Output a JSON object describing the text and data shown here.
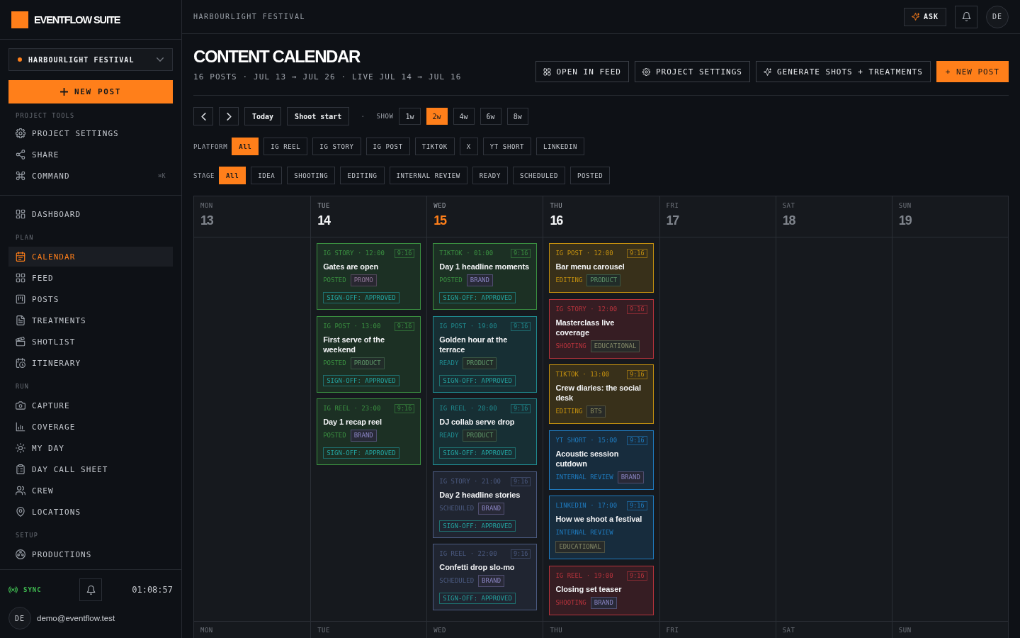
{
  "sidebar": {
    "brand": "EVENTFLOW SUITE",
    "project": "HARBOURLIGHT FESTIVAL",
    "new_post": "NEW POST",
    "tools": {
      "label": "PROJECT TOOLS",
      "items": [
        {
          "label": "PROJECT SETTINGS"
        },
        {
          "label": "SHARE"
        },
        {
          "label": "COMMAND",
          "shortcut": "⌘K"
        }
      ]
    },
    "nav": [
      {
        "items": [
          {
            "label": "DASHBOARD",
            "selected": false
          }
        ]
      },
      {
        "label": "PLAN",
        "items": [
          {
            "label": "CALENDAR",
            "selected": true
          },
          {
            "label": "FEED",
            "selected": false
          },
          {
            "label": "POSTS",
            "selected": false
          },
          {
            "label": "TREATMENTS",
            "selected": false
          },
          {
            "label": "SHOTLIST",
            "selected": false
          },
          {
            "label": "ITINERARY",
            "selected": false
          }
        ]
      },
      {
        "label": "RUN",
        "items": [
          {
            "label": "CAPTURE",
            "selected": false
          },
          {
            "label": "COVERAGE",
            "selected": false
          },
          {
            "label": "MY DAY",
            "selected": false
          },
          {
            "label": "DAY CALL SHEET",
            "selected": false
          },
          {
            "label": "CREW",
            "selected": false
          },
          {
            "label": "LOCATIONS",
            "selected": false
          }
        ]
      },
      {
        "label": "SETUP",
        "items": [
          {
            "label": "PRODUCTIONS",
            "selected": false
          }
        ]
      }
    ],
    "footer": {
      "sync": "SYNC",
      "time": "01:08:57",
      "initials": "DE",
      "email": "demo@eventflow.test"
    }
  },
  "topbar": {
    "breadcrumb": "HARBOURLIGHT FESTIVAL",
    "ask": "ASK",
    "initials": "DE"
  },
  "header": {
    "title": "CONTENT CALENDAR",
    "subtitle": "16 POSTS · JUL 13 → JUL 26 · LIVE JUL 14 → JUL 16",
    "actions": [
      {
        "label": "OPEN IN FEED",
        "kind": "outline"
      },
      {
        "label": "PROJECT SETTINGS",
        "kind": "outline"
      },
      {
        "label": "GENERATE SHOTS + TREATMENTS",
        "kind": "outline"
      },
      {
        "label": "+ NEW POST",
        "kind": "primary"
      }
    ]
  },
  "toolbar": {
    "buttons": [
      "Today",
      "Shoot start"
    ],
    "separator": "·",
    "show_label": "SHOW",
    "ranges": [
      {
        "label": "1w",
        "selected": false
      },
      {
        "label": "2w",
        "selected": true
      },
      {
        "label": "4w",
        "selected": false
      },
      {
        "label": "6w",
        "selected": false
      },
      {
        "label": "8w",
        "selected": false
      }
    ]
  },
  "filters": [
    {
      "label": "PLATFORM",
      "options": [
        {
          "label": "All",
          "selected": true
        },
        {
          "label": "IG REEL",
          "selected": false
        },
        {
          "label": "IG STORY",
          "selected": false
        },
        {
          "label": "IG POST",
          "selected": false
        },
        {
          "label": "TIKTOK",
          "selected": false
        },
        {
          "label": "X",
          "selected": false
        },
        {
          "label": "YT SHORT",
          "selected": false
        },
        {
          "label": "LINKEDIN",
          "selected": false
        }
      ]
    },
    {
      "label": "STAGE",
      "options": [
        {
          "label": "All",
          "selected": true
        },
        {
          "label": "IDEA",
          "selected": false
        },
        {
          "label": "SHOOTING",
          "selected": false
        },
        {
          "label": "EDITING",
          "selected": false
        },
        {
          "label": "INTERNAL REVIEW",
          "selected": false
        },
        {
          "label": "READY",
          "selected": false
        },
        {
          "label": "SCHEDULED",
          "selected": false
        },
        {
          "label": "POSTED",
          "selected": false
        }
      ]
    }
  ],
  "calendar": {
    "weeks": [
      {
        "days": [
          {
            "name": "MON",
            "number": "13",
            "today": false,
            "live": false
          },
          {
            "name": "TUE",
            "number": "14",
            "today": false,
            "live": true,
            "posts": [
              {
                "meta": "IG STORY · 12:00",
                "ratio": "9:16",
                "title": "Gates are open",
                "stage": "POSTED",
                "color": "#3a8f40",
                "tag": {
                  "label": "PROMO",
                  "color": "#8e7596"
                },
                "signoff": "SIGN-OFF: APPROVED"
              },
              {
                "meta": "IG POST · 13:00",
                "ratio": "9:16",
                "title": "First serve of the weekend",
                "stage": "POSTED",
                "color": "#3a8f40",
                "tag": {
                  "label": "PRODUCT",
                  "color": "#5e9468"
                },
                "signoff": "SIGN-OFF: APPROVED"
              },
              {
                "meta": "IG REEL · 23:00",
                "ratio": "9:16",
                "title": "Day 1 recap reel",
                "stage": "POSTED",
                "color": "#3a8f40",
                "tag": {
                  "label": "BRAND",
                  "color": "#8984c2"
                },
                "signoff": "SIGN-OFF: APPROVED"
              }
            ]
          },
          {
            "name": "WED",
            "number": "15",
            "today": true,
            "live": true,
            "posts": [
              {
                "meta": "TIKTOK · 01:00",
                "ratio": "9:16",
                "title": "Day 1 headline moments",
                "stage": "POSTED",
                "color": "#3a8f40",
                "tag": {
                  "label": "BRAND",
                  "color": "#8984c2"
                },
                "signoff": "SIGN-OFF: APPROVED"
              },
              {
                "meta": "IG POST · 19:00",
                "ratio": "9:16",
                "title": "Golden hour at the terrace",
                "stage": "READY",
                "color": "#1f8a8f",
                "tag": {
                  "label": "PRODUCT",
                  "color": "#5e9468"
                },
                "signoff": "SIGN-OFF: APPROVED"
              },
              {
                "meta": "IG REEL · 20:00",
                "ratio": "9:16",
                "title": "DJ collab serve drop",
                "stage": "READY",
                "color": "#1f8a8f",
                "tag": {
                  "label": "PRODUCT",
                  "color": "#5e9468"
                },
                "signoff": "SIGN-OFF: APPROVED"
              },
              {
                "meta": "IG STORY · 21:00",
                "ratio": "9:16",
                "title": "Day 2 headline stories",
                "stage": "SCHEDULED",
                "color": "#4b5a80",
                "tag": {
                  "label": "BRAND",
                  "color": "#8984c2"
                },
                "signoff": "SIGN-OFF: APPROVED"
              },
              {
                "meta": "IG REEL · 22:00",
                "ratio": "9:16",
                "title": "Confetti drop slo-mo",
                "stage": "SCHEDULED",
                "color": "#4b5a80",
                "tag": {
                  "label": "BRAND",
                  "color": "#8984c2"
                },
                "signoff": "SIGN-OFF: APPROVED"
              }
            ]
          },
          {
            "name": "THU",
            "number": "16",
            "today": false,
            "live": true,
            "posts": [
              {
                "meta": "IG POST · 12:00",
                "ratio": "9:16",
                "title": "Bar menu carousel",
                "stage": "EDITING",
                "color": "#c4900f",
                "tag": {
                  "label": "PRODUCT",
                  "color": "#5e9468"
                }
              },
              {
                "meta": "IG STORY · 12:00",
                "ratio": "9:16",
                "title": "Masterclass live coverage",
                "stage": "SHOOTING",
                "color": "#b8333c",
                "tag": {
                  "label": "EDUCATIONAL",
                  "color": "#858a68"
                }
              },
              {
                "meta": "TIKTOK · 13:00",
                "ratio": "9:16",
                "title": "Crew diaries: the social desk",
                "stage": "EDITING",
                "color": "#c4900f",
                "tag": {
                  "label": "BTS",
                  "color": "#8a8a5c"
                }
              },
              {
                "meta": "YT SHORT · 15:00",
                "ratio": "9:16",
                "title": "Acoustic session cutdown",
                "stage": "INTERNAL REVIEW",
                "color": "#1f7bbf",
                "tag": {
                  "label": "BRAND",
                  "color": "#8984c2"
                }
              },
              {
                "meta": "LINKEDIN · 17:00",
                "ratio": "9:16",
                "title": "How we shoot a festival",
                "stage": "INTERNAL REVIEW",
                "color": "#1f7bbf",
                "tag": {
                  "label": "EDUCATIONAL",
                  "color": "#858a68"
                }
              },
              {
                "meta": "IG REEL · 19:00",
                "ratio": "9:16",
                "title": "Closing set teaser",
                "stage": "SHOOTING",
                "color": "#b8333c",
                "tag": {
                  "label": "BRAND",
                  "color": "#8984c2"
                }
              }
            ]
          },
          {
            "name": "FRI",
            "number": "17",
            "today": false,
            "live": false
          },
          {
            "name": "SAT",
            "number": "18",
            "today": false,
            "live": false
          },
          {
            "name": "SUN",
            "number": "19",
            "today": false,
            "live": false
          }
        ]
      },
      {
        "days": [
          {
            "name": "MON"
          },
          {
            "name": "TUE"
          },
          {
            "name": "WED"
          },
          {
            "name": "THU"
          },
          {
            "name": "FRI"
          },
          {
            "name": "SAT"
          },
          {
            "name": "SUN"
          }
        ]
      }
    ]
  }
}
